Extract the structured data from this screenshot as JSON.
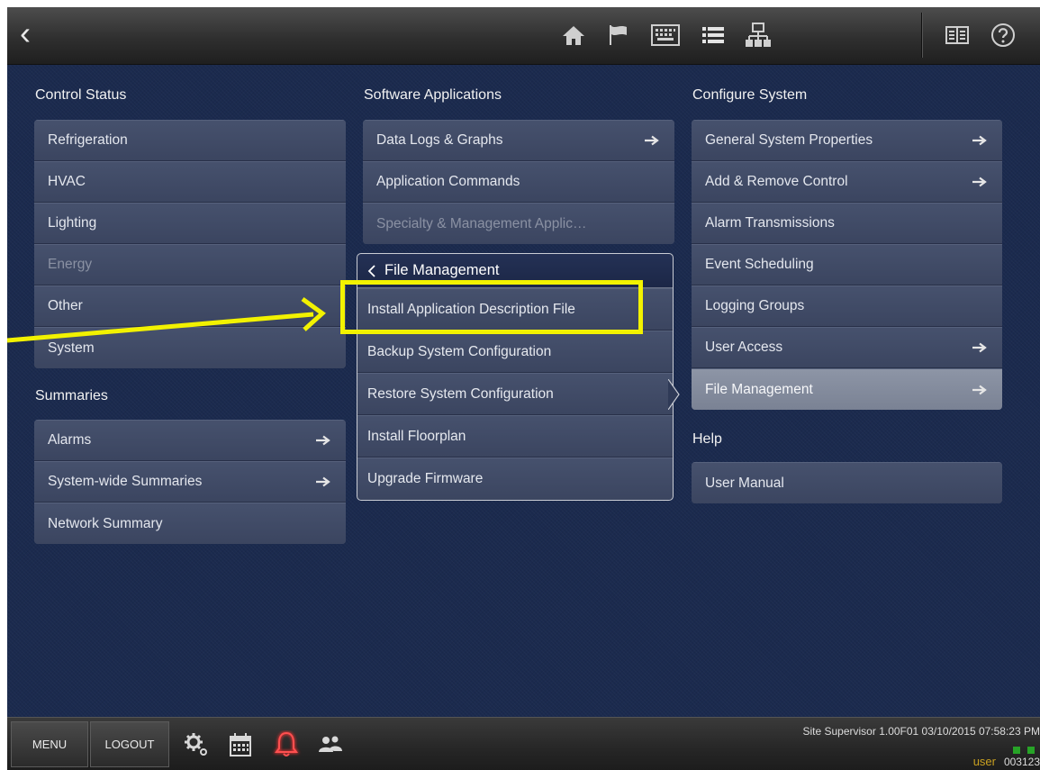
{
  "topbar": {
    "icons": [
      "home-icon",
      "flag-icon",
      "keypad-icon",
      "list-icon",
      "network-icon",
      "book-icon",
      "help-icon"
    ]
  },
  "columns": {
    "control_status": {
      "title": "Control Status",
      "items": [
        {
          "label": "Refrigeration"
        },
        {
          "label": "HVAC"
        },
        {
          "label": "Lighting"
        },
        {
          "label": "Energy",
          "disabled": true
        },
        {
          "label": "Other"
        },
        {
          "label": "System"
        }
      ]
    },
    "summaries": {
      "title": "Summaries",
      "items": [
        {
          "label": "Alarms",
          "arrow": true
        },
        {
          "label": "System-wide Summaries",
          "arrow": true
        },
        {
          "label": "Network Summary"
        }
      ]
    },
    "software_applications": {
      "title": "Software Applications",
      "items": [
        {
          "label": "Data Logs & Graphs",
          "arrow": true
        },
        {
          "label": "Application Commands"
        },
        {
          "label": "Specialty & Management Applic…",
          "disabled": true
        }
      ]
    },
    "configure_system": {
      "title": "Configure System",
      "items": [
        {
          "label": "General System Properties",
          "arrow": true
        },
        {
          "label": "Add & Remove Control",
          "arrow": true
        },
        {
          "label": "Alarm Transmissions"
        },
        {
          "label": "Event Scheduling"
        },
        {
          "label": "Logging Groups"
        },
        {
          "label": "User Access",
          "arrow": true
        },
        {
          "label": "File Management",
          "arrow": true,
          "selected": true
        }
      ]
    },
    "help": {
      "title": "Help",
      "items": [
        {
          "label": "User Manual"
        }
      ]
    }
  },
  "popup": {
    "title": "File Management",
    "items": [
      "Install Application Description File",
      "Backup System Configuration",
      "Restore System Configuration",
      "Install Floorplan",
      "Upgrade Firmware"
    ]
  },
  "bottombar": {
    "menu_label": "MENU",
    "logout_label": "LOGOUT",
    "icons": [
      "settings-icon",
      "calendar-icon",
      "alarm-bell-icon",
      "users-icon"
    ],
    "status": "Site Supervisor 1.00F01 03/10/2015 07:58:23 PM",
    "user": "user",
    "user_id": "003123"
  },
  "colors": {
    "highlight": "#f2f200",
    "alarm": "#e02020",
    "status_ok": "#27a327",
    "user_label": "#c9a020"
  }
}
